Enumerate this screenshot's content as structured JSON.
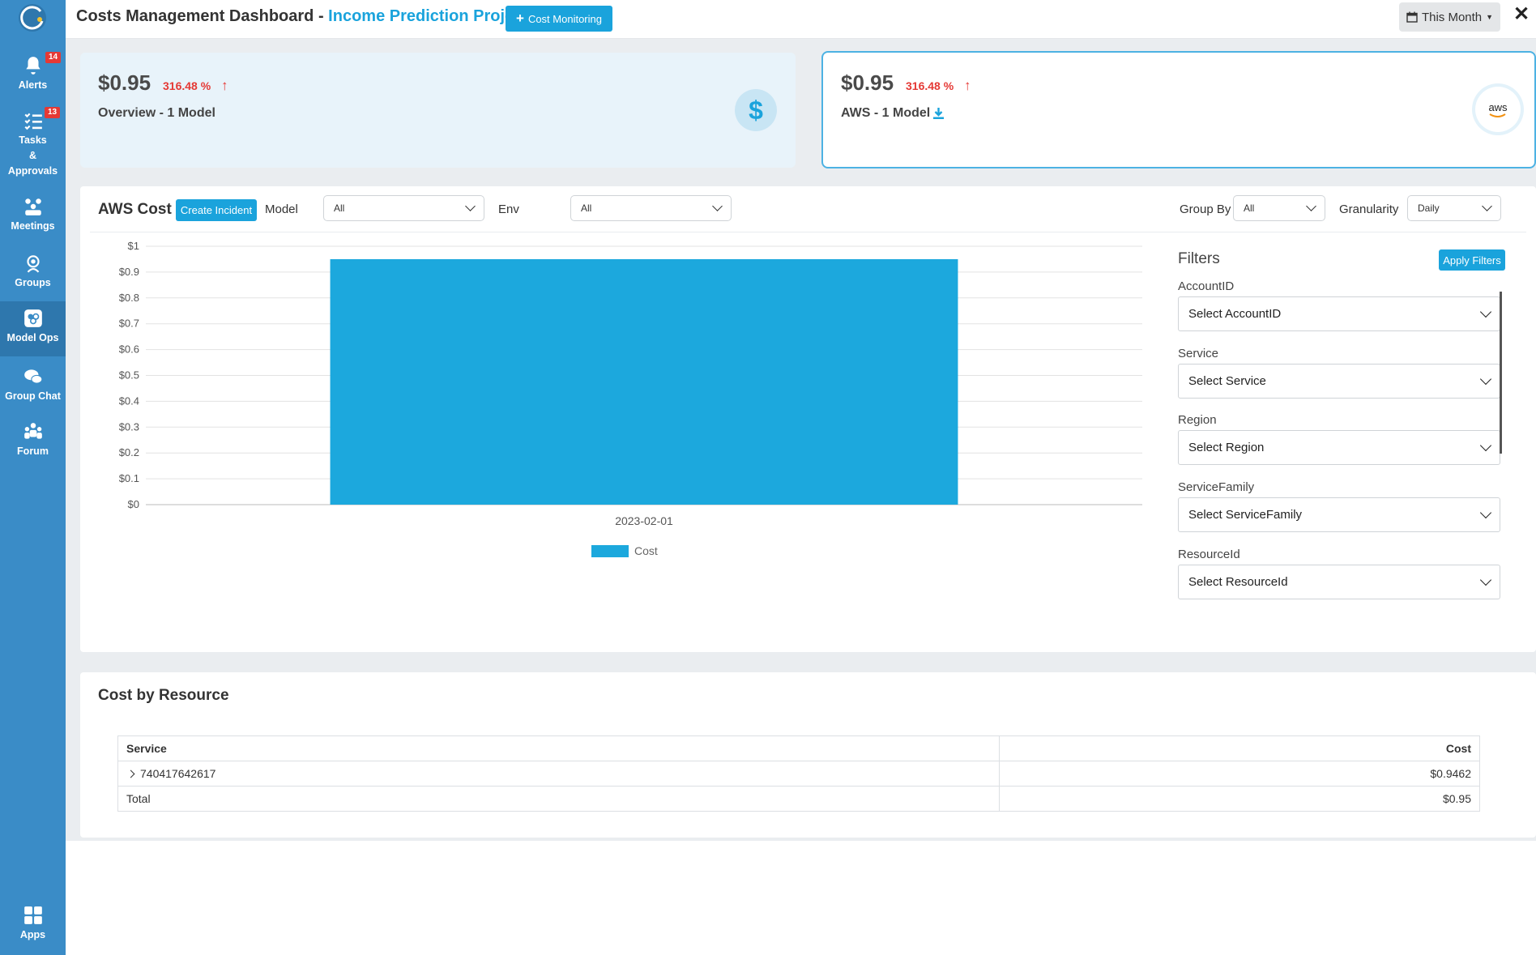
{
  "sidebar": {
    "items": [
      {
        "label": "Alerts",
        "icon": "bell-icon",
        "badge": "14"
      },
      {
        "label": "Tasks\n&\nApprovals",
        "icon": "tasks-icon",
        "badge": "13"
      },
      {
        "label": "Meetings",
        "icon": "meetings-icon"
      },
      {
        "label": "Groups",
        "icon": "groups-icon"
      },
      {
        "label": "Model Ops",
        "icon": "model-ops-icon",
        "active": true
      },
      {
        "label": "Group Chat",
        "icon": "chat-icon"
      },
      {
        "label": "Forum",
        "icon": "forum-icon"
      },
      {
        "label": "Apps",
        "icon": "apps-icon"
      }
    ]
  },
  "header": {
    "title_prefix": "Costs Management Dashboard - ",
    "project": "Income Prediction Project",
    "cost_monitoring_button": "Cost Monitoring",
    "period": "This Month"
  },
  "summary": [
    {
      "amount": "$0.95",
      "change": "316.48 %",
      "label": "Overview - 1 Model",
      "icon": "dollar-icon"
    },
    {
      "amount": "$0.95",
      "change": "316.48 %",
      "label": "AWS - 1 Model",
      "icon": "aws-logo"
    }
  ],
  "aws_cost": {
    "title": "AWS Cost",
    "create_incident": "Create Incident",
    "model_label": "Model",
    "model_value": "All",
    "env_label": "Env",
    "env_value": "All",
    "group_by_label": "Group By",
    "group_by_value": "All",
    "granularity_label": "Granularity",
    "granularity_value": "Daily"
  },
  "filters": {
    "title": "Filters",
    "apply": "Apply Filters",
    "fields": [
      {
        "label": "AccountID",
        "placeholder": "Select AccountID"
      },
      {
        "label": "Service",
        "placeholder": "Select Service"
      },
      {
        "label": "Region",
        "placeholder": "Select Region"
      },
      {
        "label": "ServiceFamily",
        "placeholder": "Select ServiceFamily"
      },
      {
        "label": "ResourceId",
        "placeholder": "Select ResourceId"
      }
    ]
  },
  "chart_data": {
    "type": "bar",
    "categories": [
      "2023-02-01"
    ],
    "series": [
      {
        "name": "Cost",
        "values": [
          0.95
        ],
        "color": "#1ca8dd"
      }
    ],
    "ylim": [
      0,
      1
    ],
    "yticks": [
      "$0",
      "$0.1",
      "$0.2",
      "$0.3",
      "$0.4",
      "$0.5",
      "$0.6",
      "$0.7",
      "$0.8",
      "$0.9",
      "$1"
    ],
    "legend_position": "bottom",
    "grid": true
  },
  "cost_by_resource": {
    "title": "Cost by Resource",
    "columns": [
      "Service",
      "Cost"
    ],
    "rows": [
      {
        "service": "740417642617",
        "cost": "$0.9462"
      }
    ],
    "total_label": "Total",
    "total_value": "$0.95"
  },
  "colors": {
    "sidebar": "#3a8cc7",
    "accent": "#1aa3dc",
    "up": "#e53935"
  }
}
